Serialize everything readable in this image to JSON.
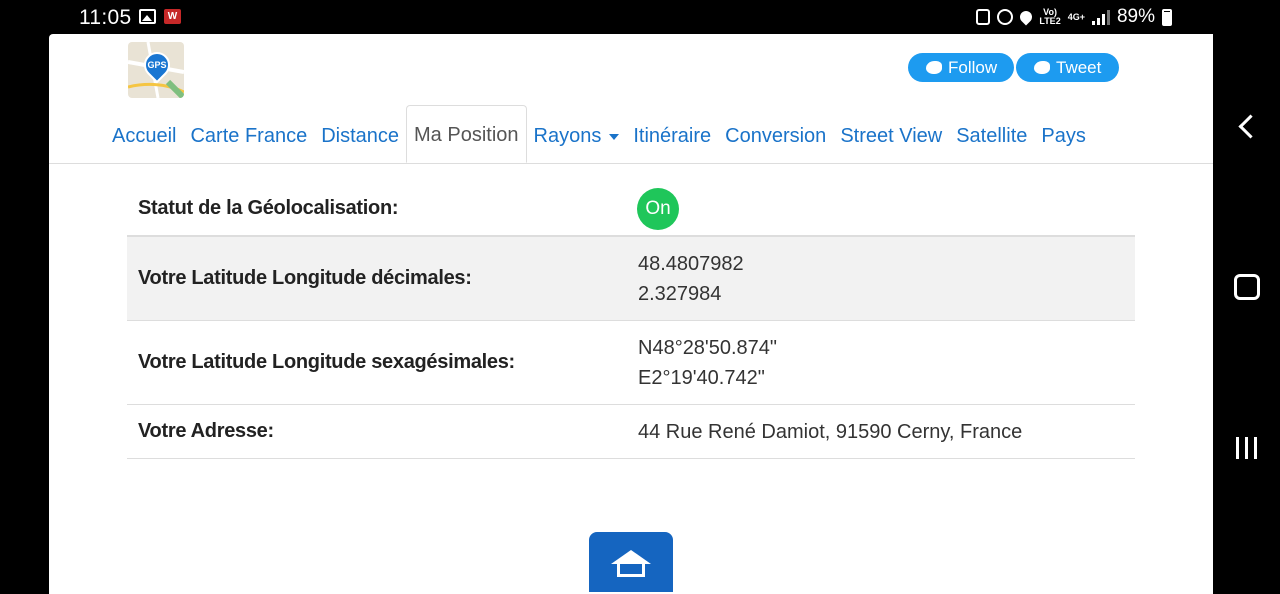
{
  "status_bar": {
    "time": "11:05",
    "w_badge": "W",
    "network_top": "Vo)",
    "network_bottom": "LTE2",
    "network_4g": "4G+",
    "battery": "89%"
  },
  "header": {
    "logo_text": "GPS",
    "follow_label": "Follow",
    "tweet_label": "Tweet"
  },
  "menu": {
    "items": [
      {
        "label": "Accueil"
      },
      {
        "label": "Carte France"
      },
      {
        "label": "Distance"
      },
      {
        "label": "Ma Position"
      },
      {
        "label": "Rayons"
      },
      {
        "label": "Itinéraire"
      },
      {
        "label": "Conversion"
      },
      {
        "label": "Street View"
      },
      {
        "label": "Satellite"
      },
      {
        "label": "Pays"
      }
    ],
    "active": "Ma Position"
  },
  "info": {
    "status_label": "Statut de la Géolocalisation:",
    "status_value": "On",
    "decimal_label": "Votre Latitude Longitude décimales:",
    "decimal_lat": "48.4807982",
    "decimal_lng": "2.327984",
    "sexa_label": "Votre Latitude Longitude sexagésimales:",
    "sexa_lat": "N48°28'50.874\"",
    "sexa_lng": "E2°19'40.742\"",
    "address_label": "Votre Adresse:",
    "address_value": "44 Rue René Damiot, 91590 Cerny, France"
  },
  "colors": {
    "link": "#1a73c9",
    "twitter": "#1d9bf0",
    "status_on": "#1fc65a",
    "fab": "#1565c0"
  }
}
